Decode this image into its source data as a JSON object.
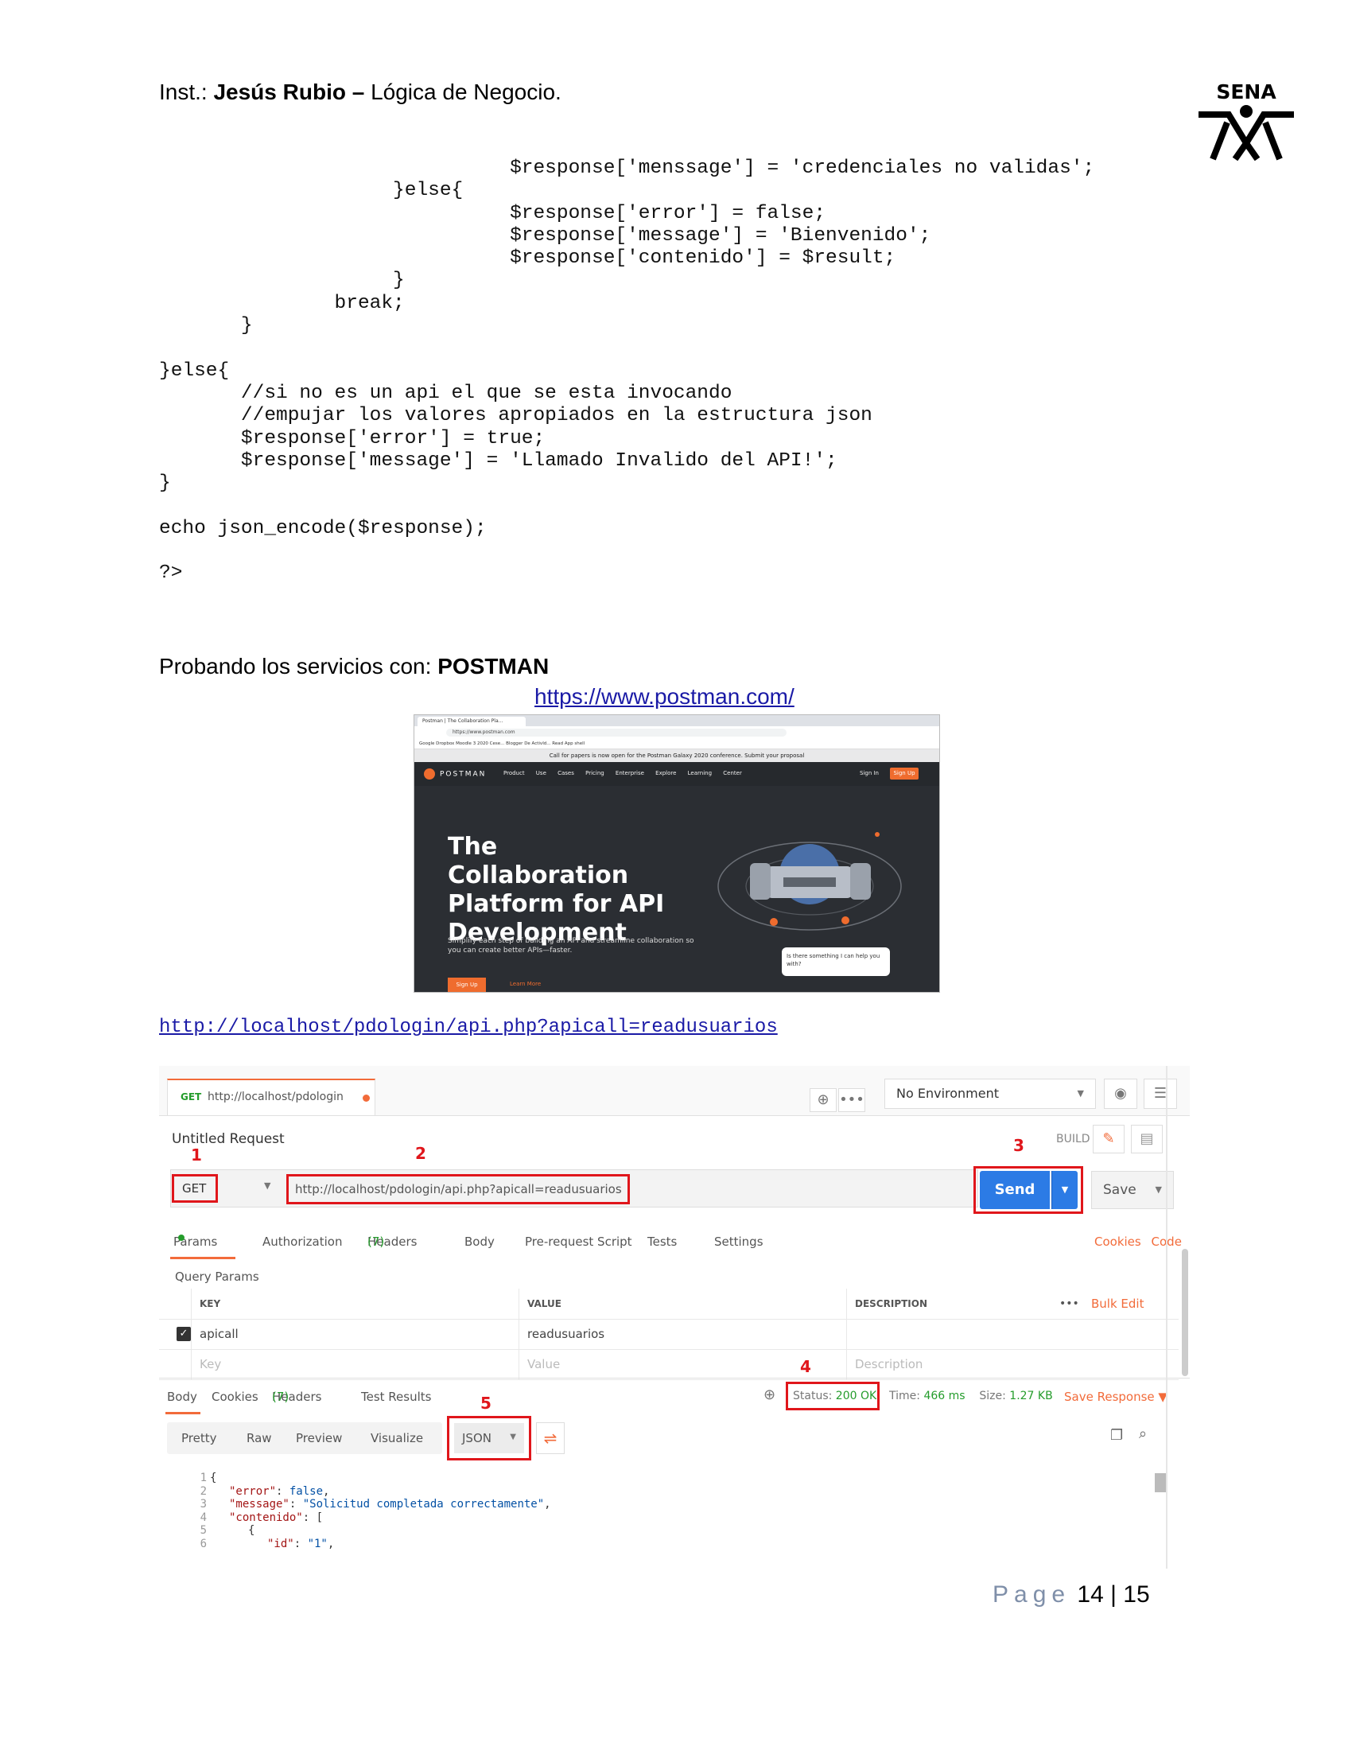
{
  "header": {
    "prefix": "Inst.: ",
    "instructor": "Jesús Rubio",
    "separator": " – ",
    "subject": "Lógica de Negocio.",
    "logo_text": "SENA"
  },
  "code": {
    "lines": [
      "                              $response['menssage'] = 'credenciales no validas';",
      "                    }else{",
      "                              $response['error'] = false;",
      "                              $response['message'] = 'Bienvenido';",
      "                              $response['contenido'] = $result;",
      "                    }",
      "               break;",
      "       }",
      "",
      "}else{",
      "       //si no es un api el que se esta invocando",
      "       //empujar los valores apropiados en la estructura json",
      "       $response['error'] = true;",
      "       $response['message'] = 'Llamado Invalido del API!';",
      "}",
      "",
      "echo json_encode($response);",
      "",
      "?>"
    ]
  },
  "section": {
    "prefix": "Probando los servicios con: ",
    "tool": "POSTMAN",
    "postman_url": "https://www.postman.com/",
    "api_url": "http://localhost/pdologin/api.php?apicall=readusuarios"
  },
  "website": {
    "tab_title": "Postman | The Collaboration Pla...",
    "address": "https://www.postman.com",
    "bookmarks": "Google   Dropbox   Moodle 3 2020 Cese...   Blogger De ActivId...   Read App   shell",
    "banner": "Call for papers is now open for the Postman Galaxy 2020 conference. Submit your proposal",
    "brand": "POSTMAN",
    "nav": "Product  Use Cases  Pricing  Enterprise  Explore  Learning Center",
    "signin": "Sign In",
    "signup": "Sign Up",
    "hero": "The Collaboration Platform for API Development",
    "subtitle": "Simplify each step of building an API and streamline collaboration so you can create better APIs—faster.",
    "cta1": "Sign Up",
    "cta2": "Learn More",
    "chat": "Is there something I can help you with?"
  },
  "postman": {
    "tab_method": "GET",
    "tab_url": "http://localhost/pdologin",
    "environment": "No Environment",
    "request_title": "Untitled Request",
    "build": "BUILD",
    "method": "GET",
    "url": "http://localhost/pdologin/api.php?apicall=readusuarios",
    "send": "Send",
    "save": "Save",
    "markers": [
      "1",
      "2",
      "3",
      "4",
      "5"
    ],
    "tabs": {
      "params": "Params",
      "authorization": "Authorization",
      "headers": "Headers",
      "headers_count": "(7)",
      "body": "Body",
      "prerequest": "Pre-request Script",
      "tests": "Tests",
      "settings": "Settings"
    },
    "cookies": "Cookies",
    "code": "Code",
    "query_params": "Query Params",
    "table": {
      "key": "KEY",
      "value": "VALUE",
      "description": "DESCRIPTION",
      "more": "•••",
      "bulk_edit": "Bulk Edit",
      "row_key": "apicall",
      "row_value": "readusuarios",
      "ph_key": "Key",
      "ph_value": "Value",
      "ph_description": "Description"
    },
    "response_tabs": {
      "body": "Body",
      "cookies": "Cookies",
      "headers": "Headers",
      "headers_count": "(7)",
      "test_results": "Test Results"
    },
    "status_label": "Status:",
    "status_value": "200 OK",
    "time_label": "Time:",
    "time_value": "466 ms",
    "size_label": "Size:",
    "size_value": "1.27 KB",
    "save_response": "Save Response",
    "views": {
      "pretty": "Pretty",
      "raw": "Raw",
      "preview": "Preview",
      "visualize": "Visualize"
    },
    "format": "JSON",
    "json_lines": [
      {
        "n": "1",
        "text": "{"
      },
      {
        "n": "2",
        "key": "\"error\"",
        "sep": ": ",
        "val": "false",
        "tail": ","
      },
      {
        "n": "3",
        "key": "\"message\"",
        "sep": ": ",
        "val": "\"Solicitud completada correctamente\"",
        "tail": ","
      },
      {
        "n": "4",
        "key": "\"contenido\"",
        "sep": ": ",
        "val": "",
        "tail": "["
      },
      {
        "n": "5",
        "text": "{"
      },
      {
        "n": "6",
        "key": "\"id\"",
        "sep": ": ",
        "val": "\"1\"",
        "tail": ","
      }
    ]
  },
  "footer": {
    "page_word": "Page",
    "current": "14",
    "sep": " | ",
    "total": "15"
  }
}
